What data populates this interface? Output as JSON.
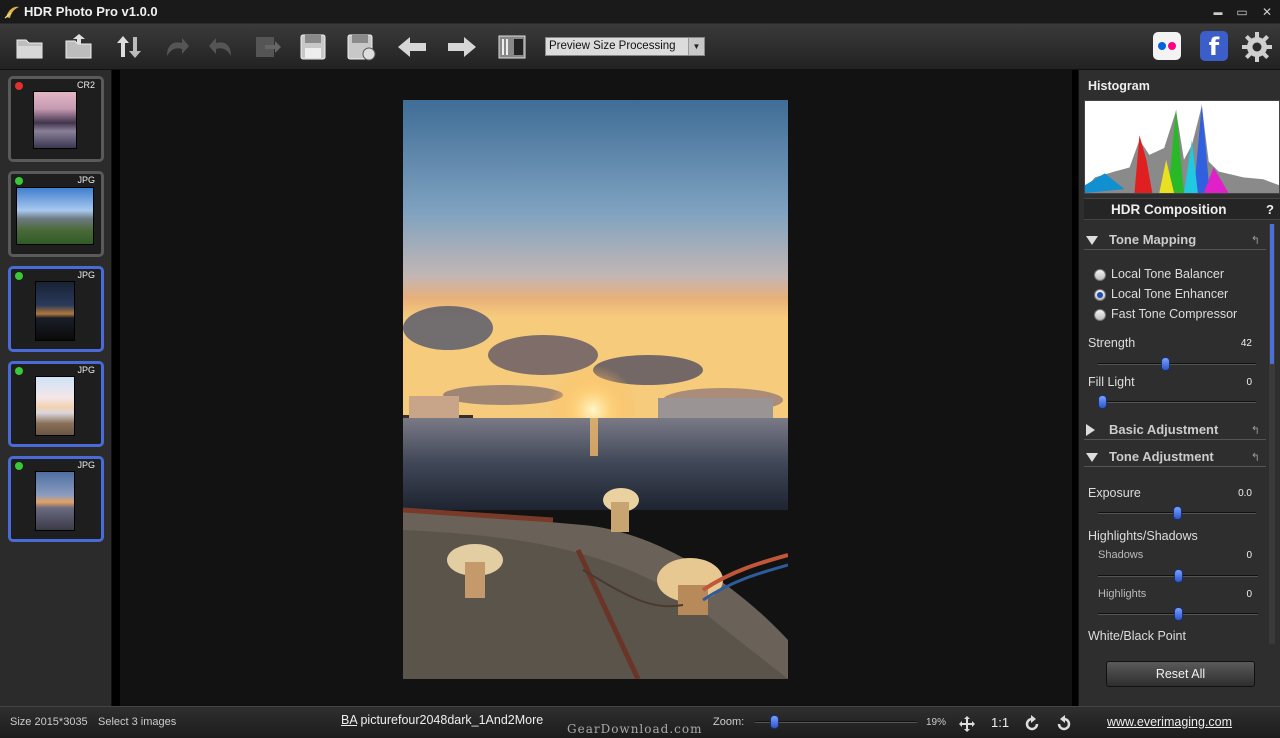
{
  "window": {
    "title": "HDR Photo Pro v1.0.0",
    "minimize": "▬",
    "maximize": "▭",
    "close": "✕"
  },
  "toolbar": {
    "buttons": [
      "open-folder-icon",
      "open-file-icon",
      "swap-icon",
      "redo-icon",
      "undo-icon",
      "export-icon",
      "save-icon",
      "save-as-icon",
      "previous-arrow-icon",
      "next-arrow-icon",
      "compare-icon"
    ],
    "preview_select": {
      "value": "Preview Size Processing",
      "arrow": "▼"
    },
    "flickr": "flickr-icon",
    "facebook": {
      "label": "f"
    },
    "settings": "gear-icon"
  },
  "filmstrip": {
    "items": [
      {
        "format": "CR2",
        "status_color": "#e03030",
        "selected": false
      },
      {
        "format": "JPG",
        "status_color": "#38c838",
        "selected": false
      },
      {
        "format": "JPG",
        "status_color": "#38c838",
        "selected": true
      },
      {
        "format": "JPG",
        "status_color": "#38c838",
        "selected": true
      },
      {
        "format": "JPG",
        "status_color": "#38c838",
        "selected": true
      }
    ]
  },
  "panel": {
    "histogram_title": "Histogram",
    "hdr_title": "HDR Composition",
    "help": "?",
    "tone_mapping": {
      "label": "Tone Mapping",
      "options": [
        "Local Tone Balancer",
        "Local Tone Enhancer",
        "Fast Tone Compressor"
      ],
      "selected_index": 1,
      "strength": {
        "label": "Strength",
        "value": "42",
        "fraction": 0.42
      },
      "fill_light": {
        "label": "Fill Light",
        "value": "0",
        "fraction": 0.0
      }
    },
    "basic_adjustment": {
      "label": "Basic Adjustment"
    },
    "tone_adjustment": {
      "label": "Tone Adjustment",
      "exposure": {
        "label": "Exposure",
        "value": "0.0",
        "fraction": 0.5
      },
      "highlights_shadows": "Highlights/Shadows",
      "shadows": {
        "label": "Shadows",
        "value": "0",
        "fraction": 0.5
      },
      "highlights": {
        "label": "Highlights",
        "value": "0",
        "fraction": 0.5
      },
      "white_black_point": "White/Black Point"
    },
    "reset_symbol": "↰",
    "reset_all": "Reset All"
  },
  "status": {
    "size": "Size 2015*3035",
    "select": "Select  3  images",
    "filename_prefix": "BA",
    "filename": " picturefour2048dark_1And2More",
    "watermark": "GearDownload.com",
    "zoom_label": "Zoom:",
    "zoom_value": "19%",
    "zoom_fraction": 0.1,
    "one_to_one": "1:1",
    "link": "www.everimaging.com"
  },
  "colors": {
    "accent": "#4a6ad8",
    "panel": "#2e2e2e",
    "canvas": "#121212"
  }
}
